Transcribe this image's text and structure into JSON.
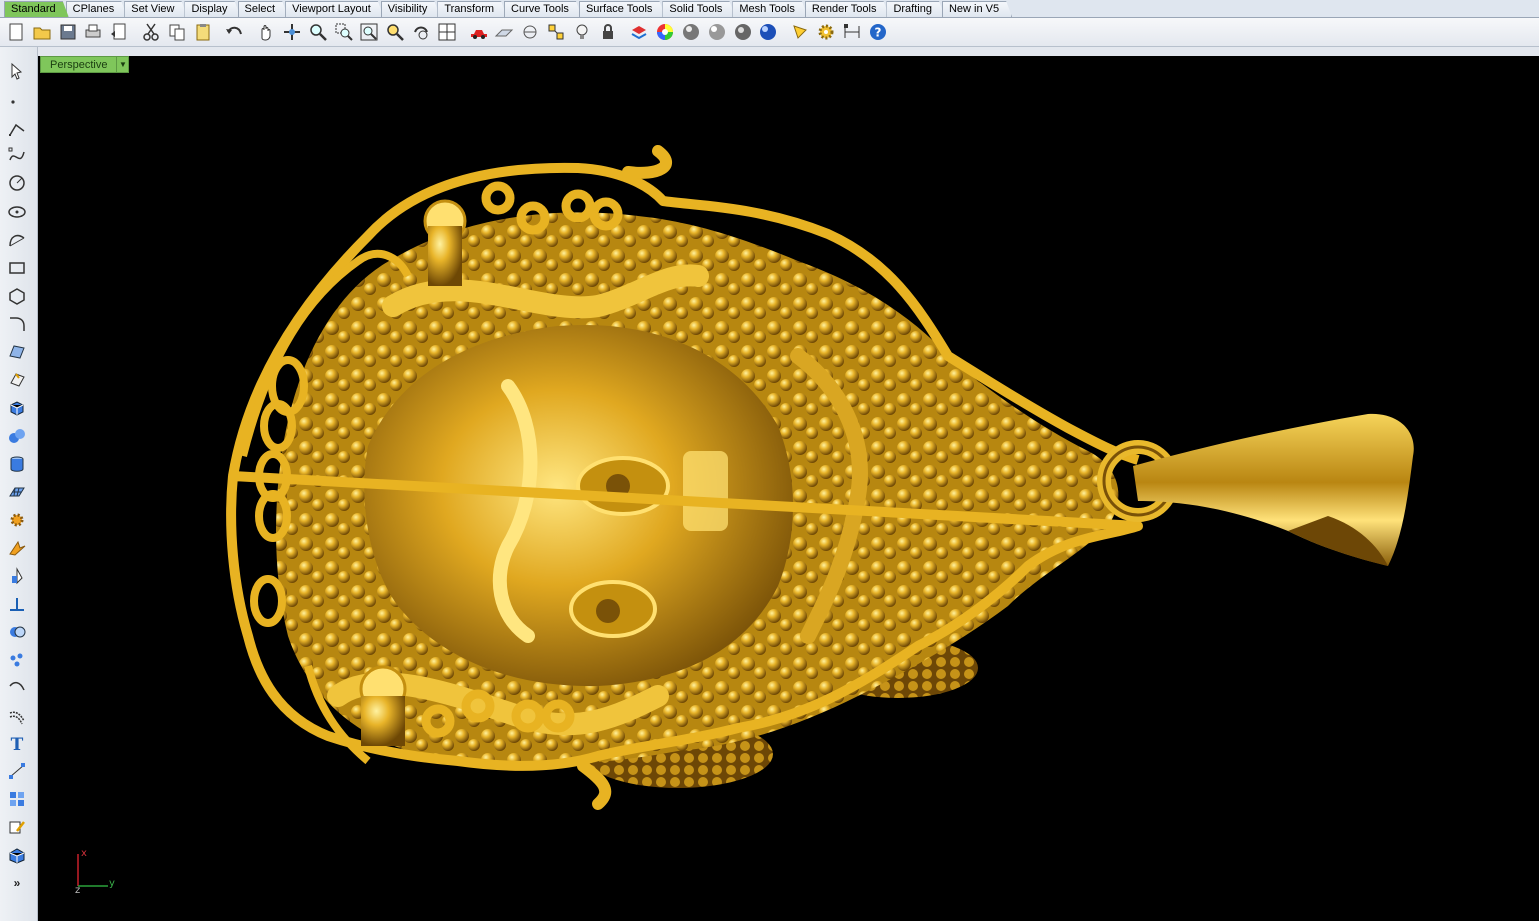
{
  "tabs": [
    {
      "label": "Standard",
      "active": true
    },
    {
      "label": "CPlanes"
    },
    {
      "label": "Set View"
    },
    {
      "label": "Display"
    },
    {
      "label": "Select"
    },
    {
      "label": "Viewport Layout"
    },
    {
      "label": "Visibility"
    },
    {
      "label": "Transform"
    },
    {
      "label": "Curve Tools"
    },
    {
      "label": "Surface Tools"
    },
    {
      "label": "Solid Tools"
    },
    {
      "label": "Mesh Tools"
    },
    {
      "label": "Render Tools"
    },
    {
      "label": "Drafting"
    },
    {
      "label": "New in V5"
    }
  ],
  "toolbar": {
    "icons": [
      "new-icon",
      "open-icon",
      "save-icon",
      "print-icon",
      "import-icon",
      "cut-icon",
      "copy-icon",
      "paste-icon",
      "undo-icon",
      "pan-hand-icon",
      "rotate-view-icon",
      "zoom-icon",
      "zoom-window-icon",
      "zoom-extents-icon",
      "zoom-selected-icon",
      "undo-view-icon",
      "four-viewports-icon",
      "car-icon",
      "cplane-icon",
      "object-snap-icon",
      "grid-snap-icon",
      "light-icon",
      "lock-icon",
      "layer-icon",
      "color-wheel-icon",
      "shaded-sphere-icon",
      "rendered-sphere-icon",
      "material-sphere-icon",
      "blue-sphere-icon",
      "spotlight-icon",
      "gear-icon",
      "dimension-icon",
      "help-icon"
    ]
  },
  "lefttools": {
    "icons": [
      "select-arrow-icon",
      "point-icon",
      "polyline-icon",
      "curve-icon",
      "circle-icon",
      "ellipse-icon",
      "arc-icon",
      "rectangle-icon",
      "polygon-icon",
      "fillet-icon",
      "surface-icon",
      "extrude-icon",
      "box-icon",
      "spheres-icon",
      "cylinder-icon",
      "mesh-icon",
      "gear-solids-icon",
      "transform-icon",
      "analyze-icon",
      "cplane-icon",
      "boolean-icon",
      "points-icon",
      "blend-curve-icon",
      "offset-curve-icon",
      "text-icon",
      "dimension-icon",
      "group-icon",
      "transform-edit-icon",
      "solid-tools-icon",
      "more-icon"
    ],
    "more_label": "»"
  },
  "viewport": {
    "title": "Perspective",
    "menu_glyph": "▼",
    "axis_x": "x",
    "axis_y": "y",
    "axis_z": "z"
  },
  "colors": {
    "gold": "#e5b42a",
    "gold_light": "#ffe070",
    "gold_dark": "#7a5208",
    "viewport_bg": "#000000",
    "active_tab": "#7fc65b"
  }
}
